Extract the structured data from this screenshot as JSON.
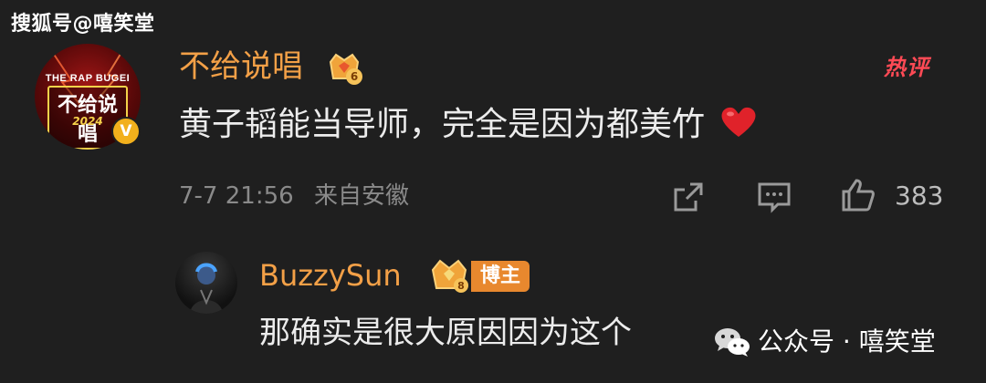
{
  "watermark_top": "搜狐号@嘻笑堂",
  "comment": {
    "avatar": {
      "brand_small": "THE RAP BUGEI",
      "brand_title": "不给说唱",
      "brand_year": "2024",
      "verified_badge": "V"
    },
    "username": "不给说唱",
    "fan_badge_level": "6",
    "hot_label": "热评",
    "text": "黄子韬能当导师，完全是因为都美竹",
    "emoji": "red-heart",
    "timestamp": "7-7 21:56",
    "source": "来自安徽",
    "actions": {
      "share_icon": "share-icon",
      "comment_icon": "comment-icon",
      "like_icon": "thumbs-up-icon",
      "like_count": "383"
    }
  },
  "reply": {
    "username": "BuzzySun",
    "fan_badge_level": "8",
    "role_badge": "博主",
    "text": "那确实是很大原因因为这个"
  },
  "watermark_bottom": "公众号 · 嘻笑堂",
  "colors": {
    "background": "#1f1f1f",
    "username": "#f3a047",
    "hot_label": "#ff4a55",
    "verified_badge": "#f2b01c",
    "role_badge": "#e8882e",
    "heart": "#e0222a"
  }
}
